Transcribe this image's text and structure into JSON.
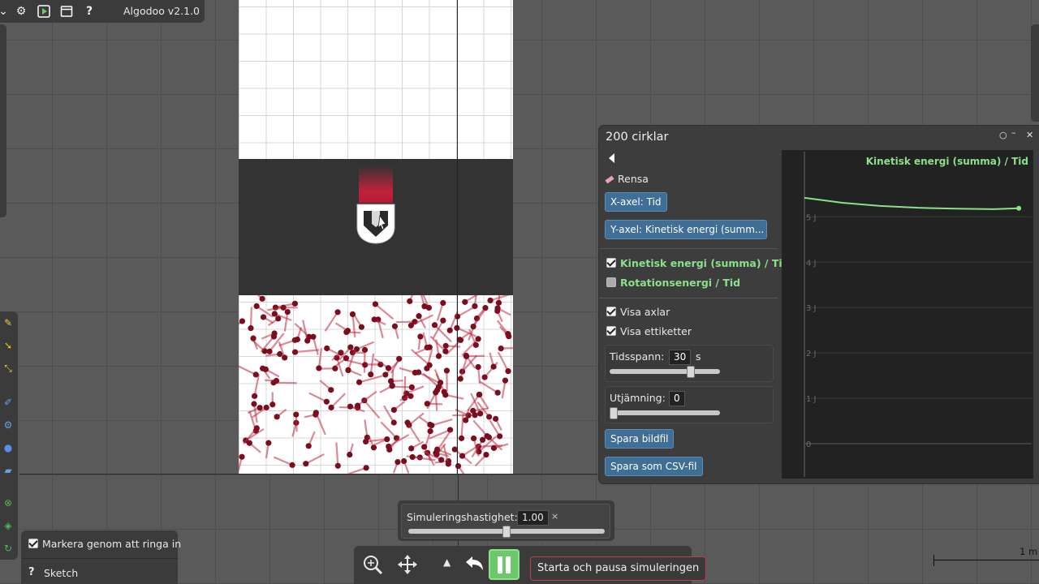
{
  "app": {
    "title": "Algodoo v2.1.0"
  },
  "toolbar": {
    "icons": [
      "gear-icon",
      "play-scene-icon",
      "window-icon",
      "help-icon"
    ],
    "help_label": "?"
  },
  "graph_window": {
    "title": "200 cirklar",
    "clear_label": "Rensa",
    "x_axis_button": "X-axel: Tid",
    "y_axis_button": "Y-axel: Kinetisk energi (summ...",
    "series_options": [
      {
        "label": "Kinetisk energi (summa) / Tid",
        "checked": true
      },
      {
        "label": "Rotationsenergi / Tid",
        "checked": false
      }
    ],
    "show_axes_label": "Visa axlar",
    "show_axes_checked": true,
    "show_labels_label": "Visa ettiketter",
    "show_labels_checked": true,
    "timespan": {
      "label": "Tidsspann:",
      "value": "30",
      "unit": "s",
      "slider_fraction": 0.75
    },
    "smoothing": {
      "label": "Utjämning:",
      "value": "0",
      "slider_fraction": 0.0
    },
    "save_image_button": "Spara bildfil",
    "save_csv_button": "Spara som CSV-fil"
  },
  "chart_data": {
    "type": "line",
    "title": "Kinetisk energi (summa) / Tid",
    "ylabel": "",
    "xlabel": "",
    "y_ticks": [
      "0",
      "1 J",
      "2 J",
      "3 J",
      "4 J",
      "5 J"
    ],
    "ylim": [
      0,
      5.9
    ],
    "xlim": [
      0,
      30
    ],
    "grid": true,
    "series": [
      {
        "name": "Kinetisk energi (summa) / Tid",
        "color": "#8be08b",
        "x": [
          0,
          5,
          10,
          15,
          20,
          25,
          28.3
        ],
        "y": [
          5.42,
          5.31,
          5.24,
          5.2,
          5.18,
          5.17,
          5.19
        ]
      }
    ]
  },
  "simulation": {
    "speed_label": "Simuleringshastighet:",
    "speed_value": "1.00",
    "speed_suffix": "×",
    "speed_fraction": 0.5,
    "tooltip": "Starta och pausa simuleringen"
  },
  "bottom_left": {
    "select_by_lasso_label": "Markera genom att ringa in",
    "select_by_lasso_checked": true,
    "sketch_label": "Sketch"
  },
  "scale": {
    "label": "1 m"
  },
  "colors": {
    "accent_green": "#6dc86b",
    "button_blue": "#3f6e96",
    "particle_red": "#7a0d1e",
    "tooltip_border": "#c23a4c"
  }
}
